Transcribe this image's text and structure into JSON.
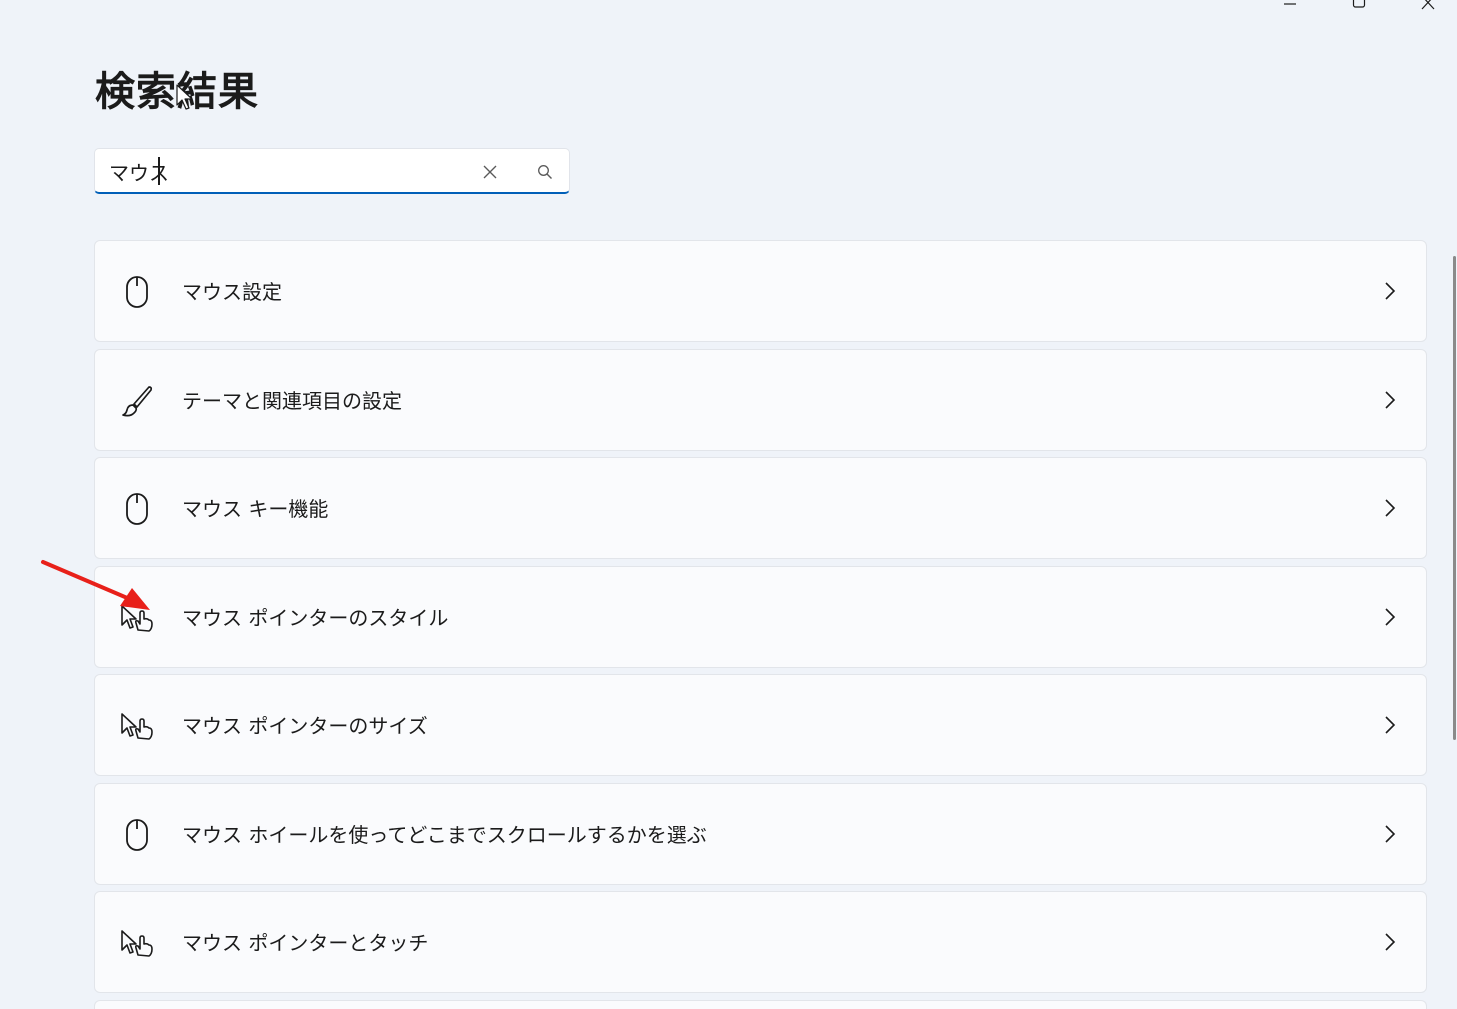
{
  "window": {
    "minimize_icon": "minimize-icon",
    "maximize_icon": "maximize-icon",
    "close_icon": "close-icon"
  },
  "page": {
    "title": "検索結果"
  },
  "search": {
    "value": "マウス",
    "clear_icon": "close-icon",
    "search_icon": "search-icon"
  },
  "results": [
    {
      "label": "マウス設定",
      "icon": "mouse-icon"
    },
    {
      "label": "テーマと関連項目の設定",
      "icon": "brush-icon"
    },
    {
      "label": "マウス キー機能",
      "icon": "mouse-icon"
    },
    {
      "label": "マウス ポインターのスタイル",
      "icon": "pointer-hand-icon"
    },
    {
      "label": "マウス ポインターのサイズ",
      "icon": "pointer-hand-icon"
    },
    {
      "label": "マウス ホイールを使ってどこまでスクロールするかを選ぶ",
      "icon": "mouse-icon"
    },
    {
      "label": "マウス ポインターとタッチ",
      "icon": "pointer-hand-icon"
    }
  ],
  "colors": {
    "background": "#eff3f9",
    "card": "#fafbfd",
    "accent": "#005fb8",
    "annotation_arrow": "#e8201a"
  }
}
